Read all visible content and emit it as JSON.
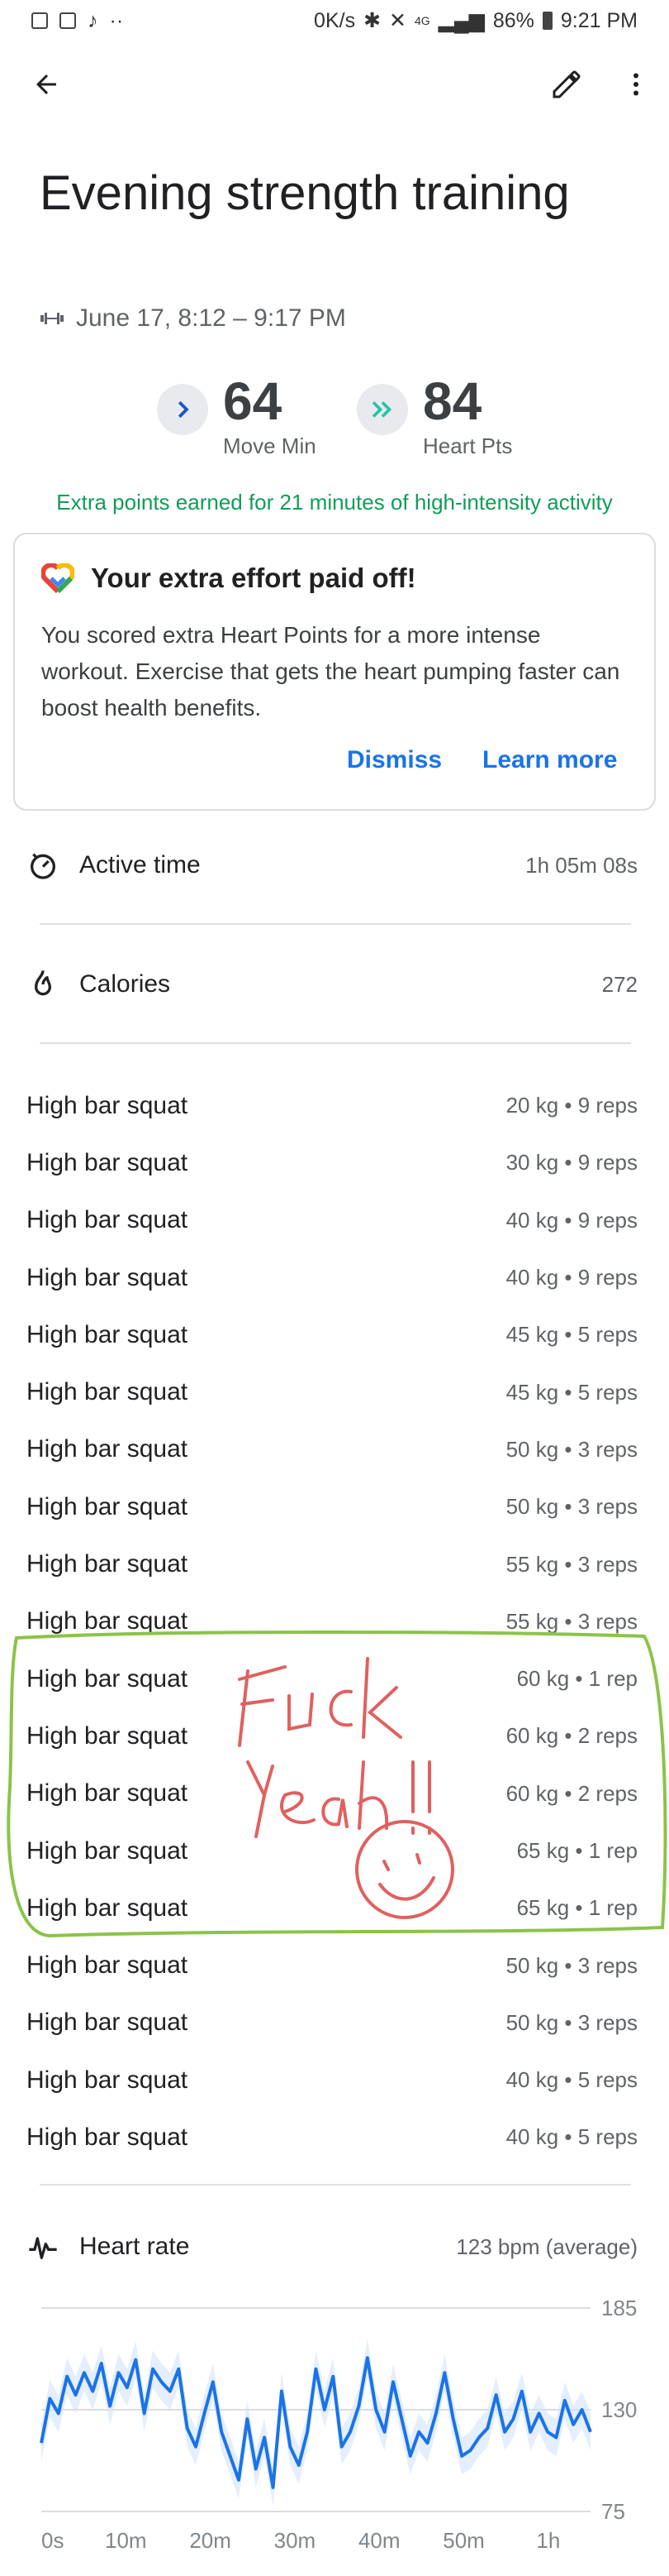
{
  "status_bar": {
    "network_speed": "0K/s",
    "signal": "4G",
    "battery": "86%",
    "time": "9:21 PM"
  },
  "workout": {
    "title": "Evening strength training",
    "date_range": "June 17, 8:12 – 9:17 PM"
  },
  "metrics": [
    {
      "value": "64",
      "label": "Move Min"
    },
    {
      "value": "84",
      "label": "Heart Pts"
    }
  ],
  "extra_points_text": "Extra points earned for 21 minutes of high-intensity activity",
  "effort_card": {
    "title": "Your extra effort paid off!",
    "body": "You scored extra Heart Points for a more intense workout. Exercise that gets the heart pumping faster can boost health benefits.",
    "dismiss": "Dismiss",
    "learn_more": "Learn more"
  },
  "stats": {
    "active_time": {
      "label": "Active time",
      "value": "1h 05m 08s"
    },
    "calories": {
      "label": "Calories",
      "value": "272"
    }
  },
  "sets": [
    {
      "exercise": "High bar squat",
      "detail": "20 kg • 9 reps"
    },
    {
      "exercise": "High bar squat",
      "detail": "30 kg • 9 reps"
    },
    {
      "exercise": "High bar squat",
      "detail": "40 kg • 9 reps"
    },
    {
      "exercise": "High bar squat",
      "detail": "40 kg • 9 reps"
    },
    {
      "exercise": "High bar squat",
      "detail": "45 kg • 5 reps"
    },
    {
      "exercise": "High bar squat",
      "detail": "45 kg • 5 reps"
    },
    {
      "exercise": "High bar squat",
      "detail": "50 kg • 3 reps"
    },
    {
      "exercise": "High bar squat",
      "detail": "50 kg • 3 reps"
    },
    {
      "exercise": "High bar squat",
      "detail": "55 kg • 3 reps"
    },
    {
      "exercise": "High bar squat",
      "detail": "55 kg • 3 reps"
    },
    {
      "exercise": "High bar squat",
      "detail": "60 kg • 1 rep"
    },
    {
      "exercise": "High bar squat",
      "detail": "60 kg • 2 reps"
    },
    {
      "exercise": "High bar squat",
      "detail": "60 kg • 2 reps"
    },
    {
      "exercise": "High bar squat",
      "detail": "65 kg • 1 rep"
    },
    {
      "exercise": "High bar squat",
      "detail": "65 kg • 1 rep"
    },
    {
      "exercise": "High bar squat",
      "detail": "50 kg • 3 reps"
    },
    {
      "exercise": "High bar squat",
      "detail": "50 kg • 3 reps"
    },
    {
      "exercise": "High bar squat",
      "detail": "40 kg • 5 reps"
    },
    {
      "exercise": "High bar squat",
      "detail": "40 kg • 5 reps"
    }
  ],
  "heart_rate": {
    "label": "Heart rate",
    "value": "123 bpm (average)",
    "y_ticks": [
      "185",
      "130",
      "75"
    ],
    "x_ticks": [
      "0s",
      "10m",
      "20m",
      "30m",
      "40m",
      "50m",
      "1h"
    ],
    "y_range": [
      75,
      185
    ],
    "x_range_min": [
      0,
      65
    ],
    "series_bpm": [
      112,
      136,
      128,
      148,
      138,
      150,
      140,
      155,
      132,
      150,
      142,
      157,
      128,
      152,
      145,
      140,
      152,
      120,
      110,
      128,
      145,
      118,
      105,
      92,
      125,
      98,
      115,
      88,
      140,
      110,
      100,
      118,
      152,
      130,
      148,
      110,
      118,
      132,
      158,
      130,
      118,
      145,
      125,
      105,
      118,
      112,
      128,
      150,
      125,
      105,
      108,
      115,
      120,
      138,
      118,
      125,
      140,
      118,
      128,
      118,
      115,
      135,
      122,
      130,
      118
    ],
    "annotation": "Fuck Yeah!!",
    "colors": {
      "line": "#1a73e8",
      "band": "#d2e3fc",
      "circle": "#8bc34a",
      "annotation": "#e06060"
    }
  },
  "icons": [
    "back-arrow-icon",
    "edit-pencil-icon",
    "more-vert-icon",
    "dumbbell-icon",
    "chevron-right-icon",
    "double-chevron-icon",
    "google-fit-heart-icon",
    "timer-icon",
    "flame-icon",
    "heart-rate-icon"
  ]
}
